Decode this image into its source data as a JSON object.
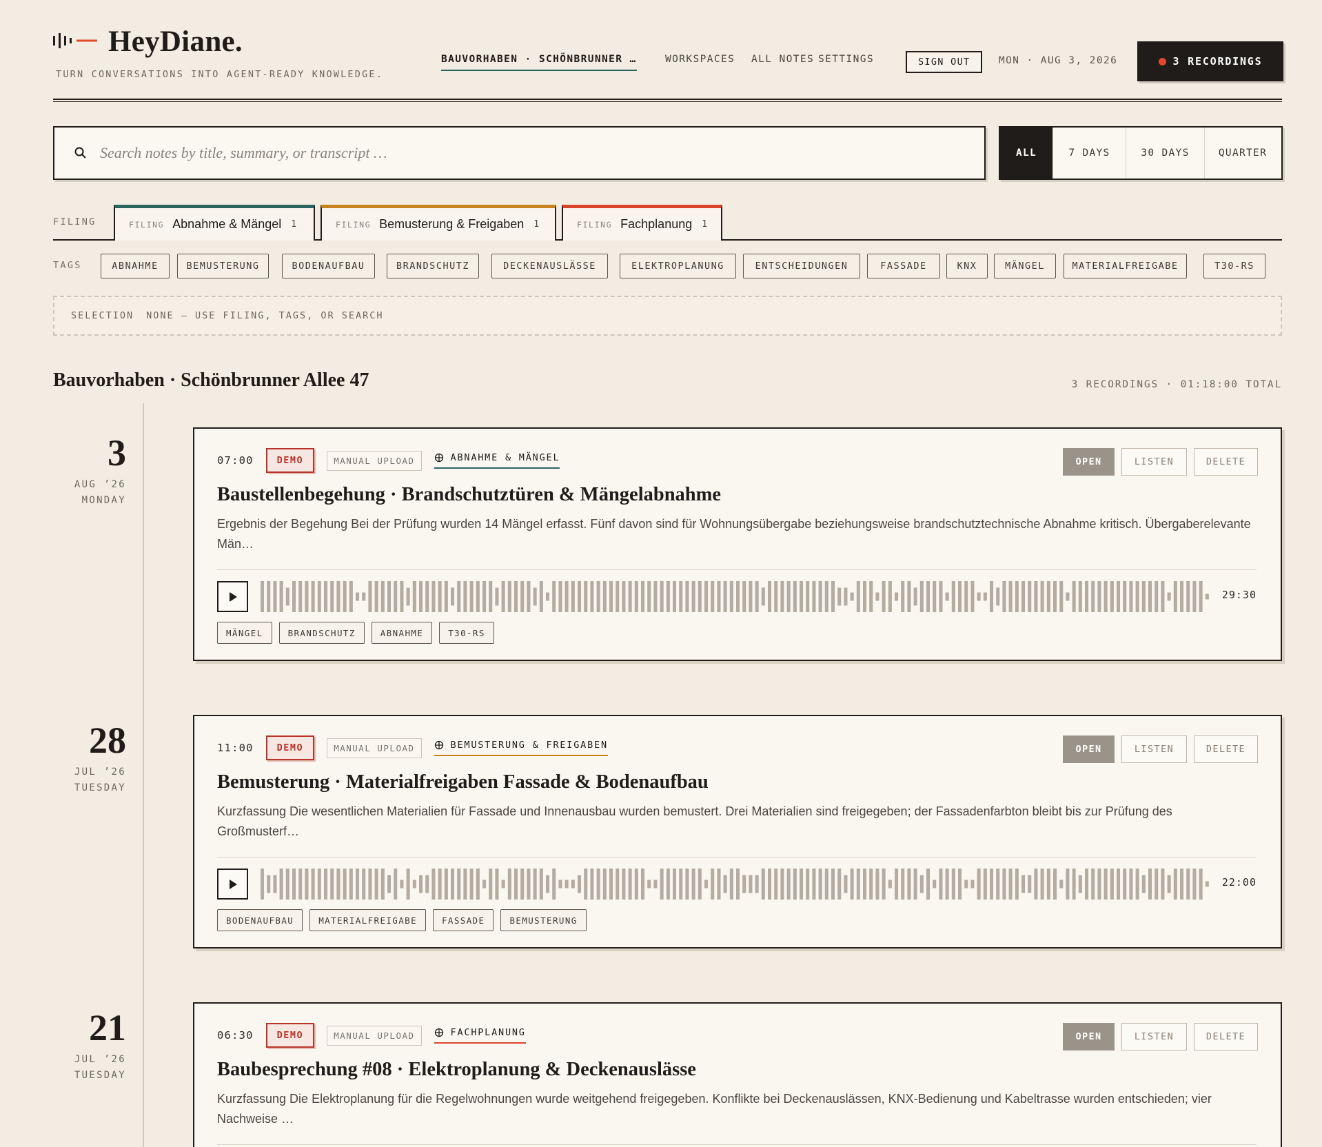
{
  "brand": {
    "name": "HeyDiane.",
    "tagline": "TURN CONVERSATIONS INTO AGENT-READY KNOWLEDGE."
  },
  "nav": {
    "project": "BAUVORHABEN · SCHÖNBRUNNER …",
    "workspaces": "WORKSPACES",
    "all_notes": "ALL NOTES",
    "settings": "SETTINGS",
    "sign_out": "SIGN OUT",
    "date": "MON · AUG 3, 2026",
    "recordings": "3 RECORDINGS"
  },
  "search": {
    "placeholder": "Search notes by title, summary, or transcript …",
    "value": ""
  },
  "range": {
    "options": [
      "ALL",
      "7 DAYS",
      "30 DAYS",
      "QUARTER"
    ],
    "selected": "ALL"
  },
  "filing": {
    "label": "FILING",
    "tabs": [
      {
        "kicker": "FILING",
        "name": "Abnahme & Mängel",
        "count": "1",
        "color": "#2b6560"
      },
      {
        "kicker": "FILING",
        "name": "Bemusterung & Freigaben",
        "count": "1",
        "color": "#c9831e"
      },
      {
        "kicker": "FILING",
        "name": "Fachplanung",
        "count": "1",
        "color": "#d8452a"
      }
    ]
  },
  "tags": {
    "label": "TAGS",
    "items": [
      "ABNAHME",
      "BEMUSTERUNG",
      "BODENAUFBAU",
      "BRANDSCHUTZ",
      "DECKENAUSLÄSSE",
      "ELEKTROPLANUNG",
      "ENTSCHEIDUNGEN",
      "FASSADE",
      "KNX",
      "MÄNGEL",
      "MATERIALFREIGABE",
      "T30-RS"
    ]
  },
  "selection": {
    "key": "SELECTION",
    "value": "NONE — USE FILING, TAGS, OR SEARCH"
  },
  "section": {
    "title": "Bauvorhaben · Schönbrunner Allee 47",
    "meta": "3 RECORDINGS · 01:18:00 TOTAL"
  },
  "actions": {
    "open": "OPEN",
    "listen": "LISTEN",
    "delete": "DELETE"
  },
  "notes": [
    {
      "day": "3",
      "month_year": "AUG ’26",
      "weekday": "MONDAY",
      "time": "07:00",
      "badge": "DEMO",
      "source": "MANUAL UPLOAD",
      "filing": "ABNAHME & MÄNGEL",
      "filing_color": "#2b6560",
      "title": "Baustellenbegehung · Brandschutztüren & Mängelabnahme",
      "summary": "Ergebnis der Begehung Bei der Prüfung wurden 14 Mängel erfasst. Fünf davon sind für Wohnungsübergabe beziehungsweise brandschutztechnische Abnahme kritisch. Übergaberelevante Män…",
      "duration": "29:30",
      "tags": [
        "MÄNGEL",
        "BRANDSCHUTZ",
        "ABNAHME",
        "T30-RS"
      ]
    },
    {
      "day": "28",
      "month_year": "JUL ’26",
      "weekday": "TUESDAY",
      "time": "11:00",
      "badge": "DEMO",
      "source": "MANUAL UPLOAD",
      "filing": "BEMUSTERUNG & FREIGABEN",
      "filing_color": "#c9831e",
      "title": "Bemusterung · Materialfreigaben Fassade & Bodenaufbau",
      "summary": "Kurzfassung Die wesentlichen Materialien für Fassade und Innenausbau wurden bemustert. Drei Materialien sind freigegeben; der Fassadenfarbton bleibt bis zur Prüfung des Großmusterf…",
      "duration": "22:00",
      "tags": [
        "BODENAUFBAU",
        "MATERIALFREIGABE",
        "FASSADE",
        "BEMUSTERUNG"
      ]
    },
    {
      "day": "21",
      "month_year": "JUL ’26",
      "weekday": "TUESDAY",
      "time": "06:30",
      "badge": "DEMO",
      "source": "MANUAL UPLOAD",
      "filing": "FACHPLANUNG",
      "filing_color": "#d8452a",
      "title": "Baubesprechung #08 · Elektroplanung & Deckenauslässe",
      "summary": "Kurzfassung Die Elektroplanung für die Regelwohnungen wurde weitgehend freigegeben. Konflikte bei Deckenauslässen, KNX-Bedienung und Kabeltrasse wurden entschieden; vier Nachweise …",
      "duration": "",
      "tags": []
    }
  ]
}
